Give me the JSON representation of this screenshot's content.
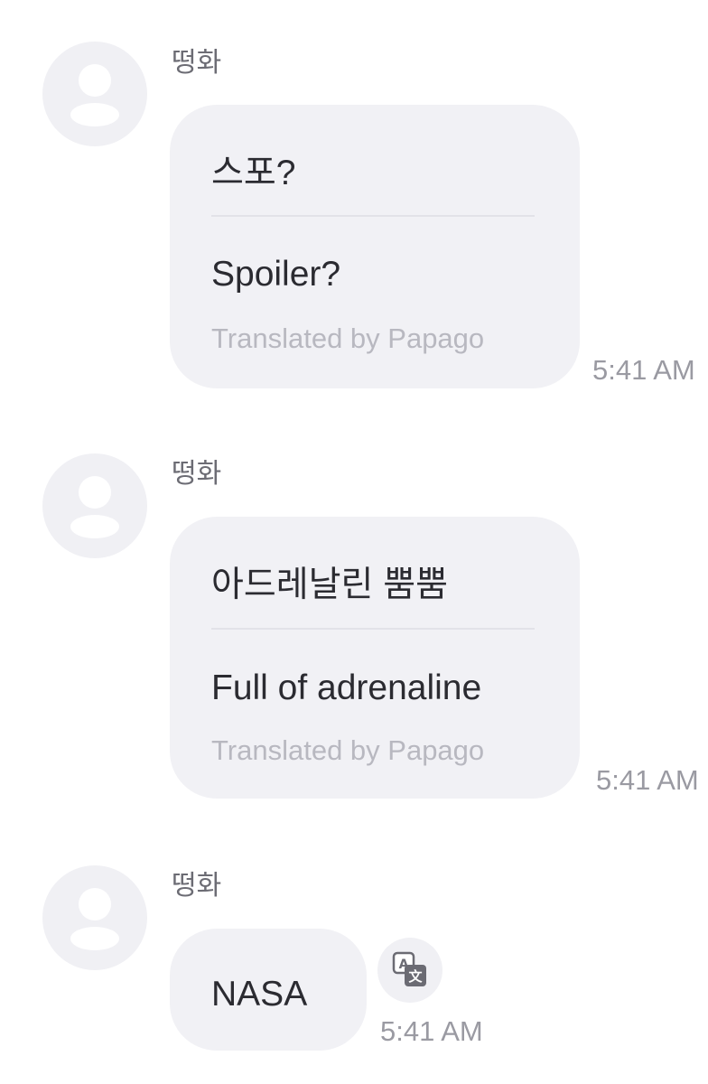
{
  "messages": [
    {
      "sender": "떵화",
      "original": "스포?",
      "translation": "Spoiler?",
      "credit": "Translated by Papago",
      "time": "5:41 AM"
    },
    {
      "sender": "떵화",
      "original": "아드레날린 뿜뿜",
      "translation": "Full of adrenaline",
      "credit": "Translated by Papago",
      "time": "5:41 AM"
    },
    {
      "sender": "떵화",
      "original": "NASA",
      "time": "5:41 AM",
      "action_icon": "translate-icon"
    }
  ]
}
